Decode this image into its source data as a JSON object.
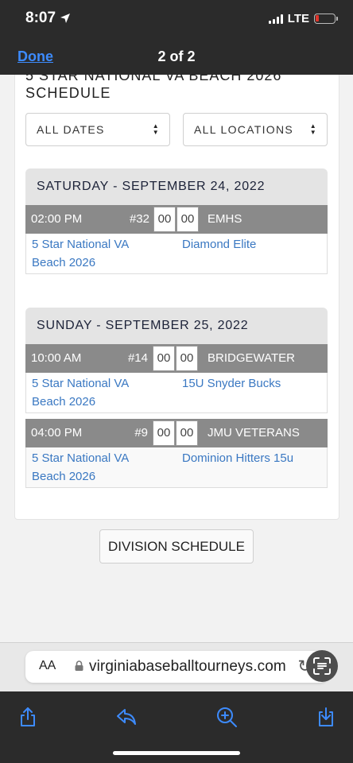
{
  "status": {
    "time": "8:07",
    "network": "LTE"
  },
  "nav": {
    "done_label": "Done",
    "page_indicator": "2 of 2"
  },
  "schedule": {
    "title_partial": "5 STAR NATIONAL VA BEACH 2026",
    "title_line2": "SCHEDULE",
    "filters": {
      "dates": "ALL DATES",
      "locations": "ALL LOCATIONS"
    },
    "days": [
      {
        "label": "SATURDAY - SEPTEMBER 24, 2022",
        "games": [
          {
            "time": "02:00 PM",
            "number": "#32",
            "score_home": "00",
            "score_away": "00",
            "opponent_header": "EMHS",
            "team1_line1": "5 Star National VA",
            "team1_line2": "Beach 2026",
            "team2": "Diamond Elite"
          }
        ]
      },
      {
        "label": "SUNDAY - SEPTEMBER 25, 2022",
        "games": [
          {
            "time": "10:00 AM",
            "number": "#14",
            "score_home": "00",
            "score_away": "00",
            "opponent_header": "BRIDGEWATER",
            "team1_line1": "5 Star National VA",
            "team1_line2": "Beach 2026",
            "team2": "15U Snyder Bucks"
          },
          {
            "time": "04:00 PM",
            "number": "#9",
            "score_home": "00",
            "score_away": "00",
            "opponent_header": "JMU VETERANS",
            "team1_line1": "5 Star National VA",
            "team1_line2": "Beach 2026",
            "team2": "Dominion Hitters 15u"
          }
        ]
      }
    ],
    "division_button": "DIVISION SCHEDULE"
  },
  "address_bar": {
    "aa_label": "AA",
    "url": "virginiabaseballtourneys.com"
  },
  "icons": [
    "location-arrow-icon",
    "signal-icon",
    "battery-icon",
    "lock-icon",
    "reload-icon",
    "text-scan-icon",
    "share-icon",
    "reply-icon",
    "zoom-icon",
    "download-icon"
  ],
  "colors": {
    "link": "#3a78c2",
    "nav_link": "#3d8bfd",
    "header_gray": "#8a8a8a",
    "day_gray": "#e4e4e4",
    "battery_low": "#e0352b"
  }
}
